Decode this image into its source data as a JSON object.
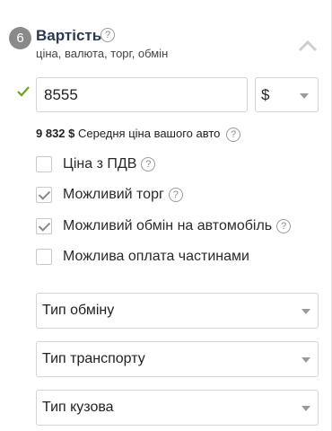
{
  "section": {
    "step_number": "6",
    "title": "Вартість",
    "subtitle": "ціна, валюта, торг, обмін"
  },
  "price": {
    "value": "8555",
    "currency": "$"
  },
  "average": {
    "amount": "9 832 $",
    "label": "Середня ціна вашого авто"
  },
  "options": [
    {
      "label": "Ціна з ПДВ",
      "checked": false,
      "help": true
    },
    {
      "label": "Можливий торг",
      "checked": true,
      "help": true
    },
    {
      "label": "Можливий обмін на автомобіль",
      "checked": true,
      "help": true
    },
    {
      "label": "Можлива оплата частинами",
      "checked": false,
      "help": false
    }
  ],
  "exchange_filters": [
    {
      "label": "Тип обміну"
    },
    {
      "label": "Тип транспорту"
    },
    {
      "label": "Тип кузова"
    }
  ],
  "colors": {
    "accent_check": "#6aa31f",
    "title_color": "#2a3a52"
  }
}
